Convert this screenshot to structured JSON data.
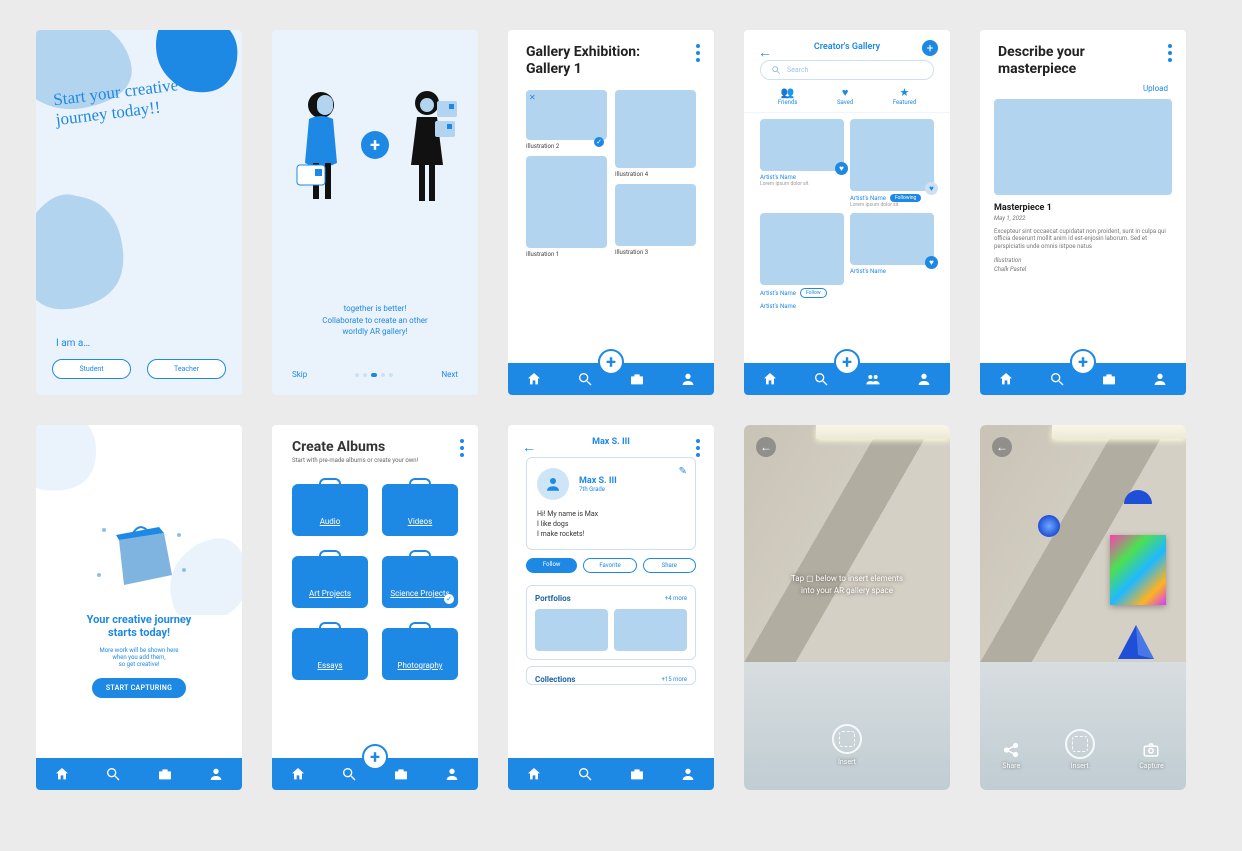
{
  "s1": {
    "headline_l1": "Start your creative",
    "headline_l2": "journey today!!",
    "prompt": "I am a…",
    "btn_student": "Student",
    "btn_teacher": "Teacher"
  },
  "s2": {
    "tagline_l1": "together is better!",
    "tagline_l2": "Collaborate to create an other",
    "tagline_l3": "worldly AR gallery!",
    "skip": "Skip",
    "next": "Next"
  },
  "s3": {
    "title_l1": "Gallery Exhibition:",
    "title_l2": "Gallery 1",
    "c2": "Illustration 2",
    "c4": "Illustration 4",
    "c1": "Illustration 1",
    "c3": "Illustration 3"
  },
  "s4": {
    "title": "Creator's Gallery",
    "search_ph": "Search",
    "tab_friends": "Friends",
    "tab_saved": "Saved",
    "tab_featured": "Featured",
    "artist": "Artist's Name",
    "following": "Following",
    "follow": "Follow"
  },
  "s5": {
    "title_l1": "Describe your",
    "title_l2": "masterpiece",
    "upload": "Upload",
    "name": "Masterpiece 1",
    "date": "May 1, 2022",
    "lorem": "Excepteur sint occaecat cupidatat non proident, sunt in culpa qui officia deserunt mollit anim id est-enjosin laborum. Sed et perspiciatis unde omnis istpoe natus",
    "lbl1": "Illustration",
    "lbl2": "Chalk Pastel"
  },
  "s6": {
    "title_l1": "Your creative journey",
    "title_l2": "starts today!",
    "sub_l1": "More work will be shown here",
    "sub_l2": "when you add them,",
    "sub_l3": "so get creative!",
    "cta": "START CAPTURING"
  },
  "s7": {
    "title": "Create Albums",
    "subtitle": "Start with pre-made albums or create your own!",
    "albums": [
      "Audio",
      "Videos",
      "Art Projects",
      "Science Projects",
      "Essays",
      "Photography"
    ]
  },
  "s8": {
    "user": "Max S. III",
    "grade": "7th Grade",
    "bio_l1": "Hi! My name is Max",
    "bio_l2": "I like dogs",
    "bio_l3": "I make rockets!",
    "btn_follow": "Follow",
    "btn_fav": "Favorite",
    "btn_share": "Share",
    "sec_port": "Portfolios",
    "port_more": "+4 more",
    "sec_coll": "Collections",
    "coll_more": "+15 more"
  },
  "s9": {
    "hint_l1": "Tap ▢ below to insert elements",
    "hint_l2": "into your AR gallery space",
    "btn": "Insert"
  },
  "s10": {
    "share": "Share",
    "insert": "Insert",
    "capture": "Capture"
  }
}
